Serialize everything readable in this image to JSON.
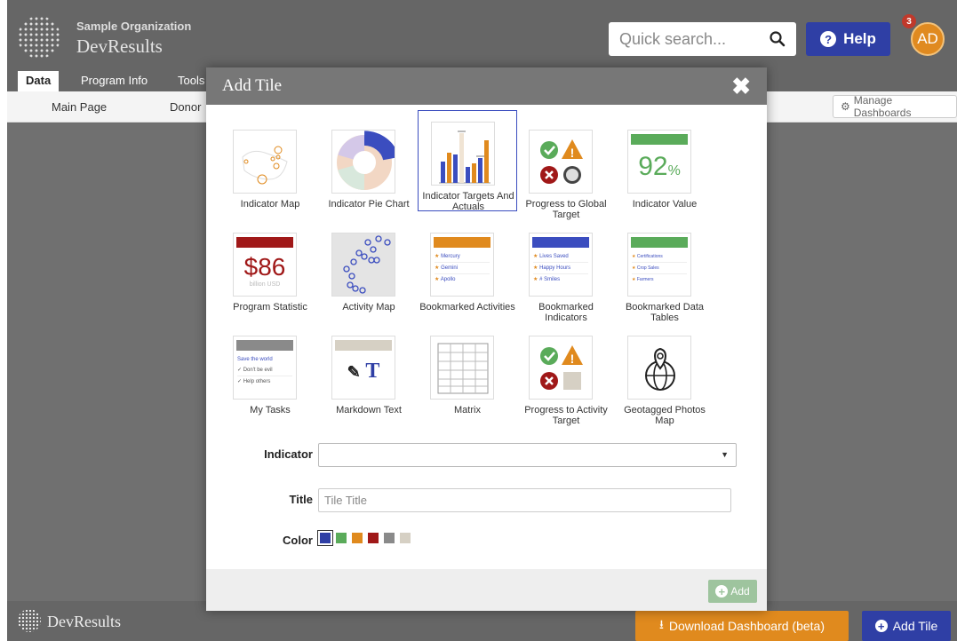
{
  "app": {
    "org": "Sample Organization",
    "brand": "DevResults"
  },
  "header": {
    "search_placeholder": "Quick search...",
    "help_label": "Help",
    "avatar_initials": "AD",
    "notification_count": "3"
  },
  "nav": {
    "tabs": [
      "Data",
      "Program Info",
      "Tools"
    ]
  },
  "subnav": {
    "items": [
      "Main Page",
      "Donor"
    ],
    "manage_label": "Manage Dashboards"
  },
  "footer": {
    "brand": "DevResults",
    "download_label": "Download Dashboard (beta)",
    "add_tile_label": "Add Tile"
  },
  "modal": {
    "title": "Add Tile",
    "tiles": [
      {
        "label": "Indicator Map",
        "icon": "indicator-map"
      },
      {
        "label": "Indicator Pie Chart",
        "icon": "pie-chart"
      },
      {
        "label": "Indicator Targets And Actuals",
        "icon": "bar-chart",
        "selected": true
      },
      {
        "label": "Progress to Global Target",
        "icon": "progress-status"
      },
      {
        "label": "Indicator Value",
        "icon": "value-number"
      },
      {
        "label": "Program Statistic",
        "icon": "statistic"
      },
      {
        "label": "Activity Map",
        "icon": "activity-map"
      },
      {
        "label": "Bookmarked Activities",
        "icon": "bookmark-list"
      },
      {
        "label": "Bookmarked Indicators",
        "icon": "bookmark-list"
      },
      {
        "label": "Bookmarked Data Tables",
        "icon": "bookmark-list"
      },
      {
        "label": "My Tasks",
        "icon": "tasks"
      },
      {
        "label": "Markdown Text",
        "icon": "markdown"
      },
      {
        "label": "Matrix",
        "icon": "matrix"
      },
      {
        "label": "Progress to Activity Target",
        "icon": "progress-status"
      },
      {
        "label": "Geotagged Photos Map",
        "icon": "globe-pin"
      }
    ],
    "thumb_text": {
      "value_number": "92",
      "value_unit": "%",
      "statistic_value": "$86",
      "statistic_sub": "billion USD",
      "activities": [
        "Mercury",
        "Gemini",
        "Apollo"
      ],
      "indicators": [
        "Lives Saved",
        "Happy Hours",
        "# Smiles"
      ],
      "tables": [
        "Certifications",
        "Crop Sales",
        "Farmers"
      ],
      "tasks_title": "Save the world",
      "tasks": [
        "Don't be evil",
        "Help others"
      ],
      "markdown_glyph": "T"
    },
    "form": {
      "indicator_label": "Indicator",
      "indicator_value": "",
      "title_label": "Title",
      "title_placeholder": "Tile Title",
      "color_label": "Color",
      "colors": [
        "#2f3fa5",
        "#5aab5a",
        "#e08a1e",
        "#a01818",
        "#8a8a8a",
        "#d6d0c4"
      ]
    },
    "add_label": "Add"
  }
}
